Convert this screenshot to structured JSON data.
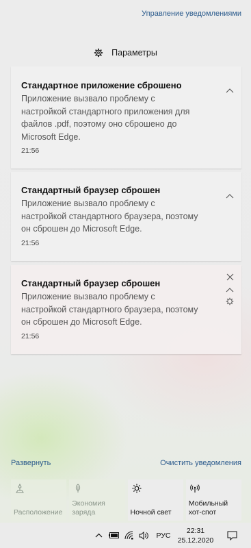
{
  "header": {
    "manage_label": "Управление уведомлениями"
  },
  "group": {
    "name": "Параметры",
    "icon": "gear-icon"
  },
  "notifications": [
    {
      "title": "Стандартное приложение сброшено",
      "body": [
        "Приложение вызвало проблему с",
        "настройкой стандартного приложения для",
        "файлов .pdf, поэтому оно сброшено до",
        "Microsoft Edge."
      ],
      "time": "21:56"
    },
    {
      "title": "Стандартный браузер сброшен",
      "body": [
        "Приложение вызвало проблему с",
        "настройкой стандартного браузера, поэтому",
        "он сброшен до Microsoft Edge."
      ],
      "time": "21:56"
    },
    {
      "title": "Стандартный браузер сброшен",
      "body": [
        "Приложение вызвало проблему с",
        "настройкой стандартного браузера, поэтому",
        "он сброшен до Microsoft Edge."
      ],
      "time": "21:56"
    }
  ],
  "footer": {
    "expand_label": "Развернуть",
    "clear_label": "Очистить уведомления"
  },
  "quick_actions": [
    {
      "label": "Расположение",
      "icon": "location-icon",
      "enabled": false
    },
    {
      "label": "Экономия заряда",
      "icon": "battery-saver-icon",
      "enabled": false
    },
    {
      "label": "Ночной свет",
      "icon": "sun-icon",
      "enabled": true
    },
    {
      "label": "Мобильный хот-спот",
      "icon": "hotspot-icon",
      "enabled": true
    }
  ],
  "taskbar": {
    "language": "РУС",
    "time": "22:31",
    "date": "25.12.2020",
    "icons": [
      "chevron-up-icon",
      "battery-icon",
      "wifi-icon",
      "volume-icon",
      "action-center-icon"
    ]
  }
}
